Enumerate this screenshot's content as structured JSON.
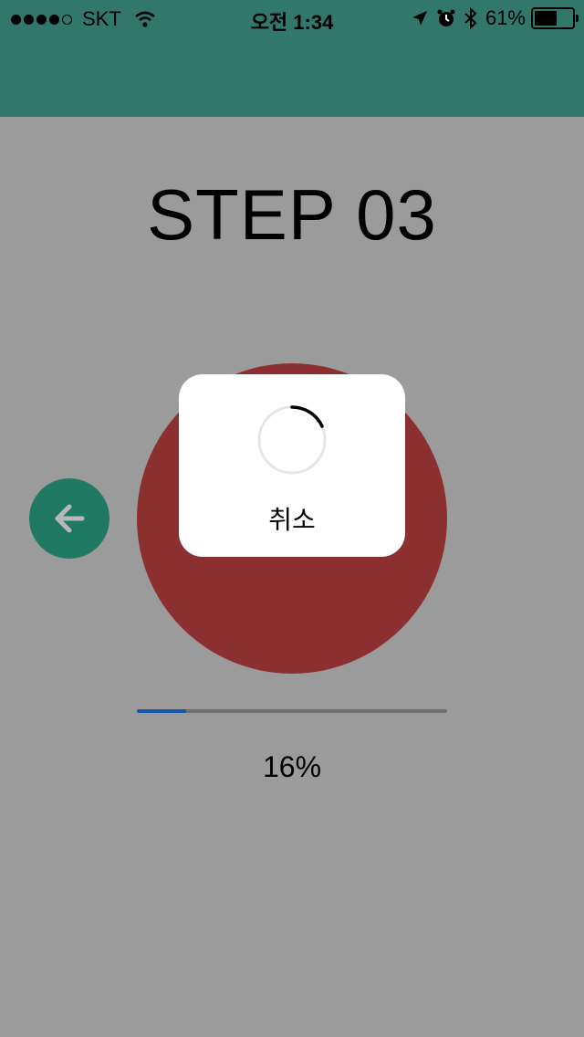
{
  "status_bar": {
    "carrier": "SKT",
    "time": "오전 1:34",
    "battery": "61%",
    "battery_level": 0.61,
    "signal_bars_filled": 4
  },
  "screen": {
    "title": "STEP 03",
    "progress_value": 16,
    "progress_text": "16%"
  },
  "dialog": {
    "cancel_label": "취소"
  },
  "colors": {
    "header": "#31786a",
    "background": "#9b9b9b",
    "record_circle": "#8c2f31",
    "back_button": "#207a63",
    "progress_fill": "#1a56a8"
  },
  "icons": {
    "back": "arrow-left-icon",
    "spinner": "loading-spinner-icon",
    "wifi": "wifi-icon",
    "location": "location-arrow-icon",
    "alarm": "alarm-icon",
    "bluetooth": "bluetooth-icon",
    "battery": "battery-icon"
  }
}
